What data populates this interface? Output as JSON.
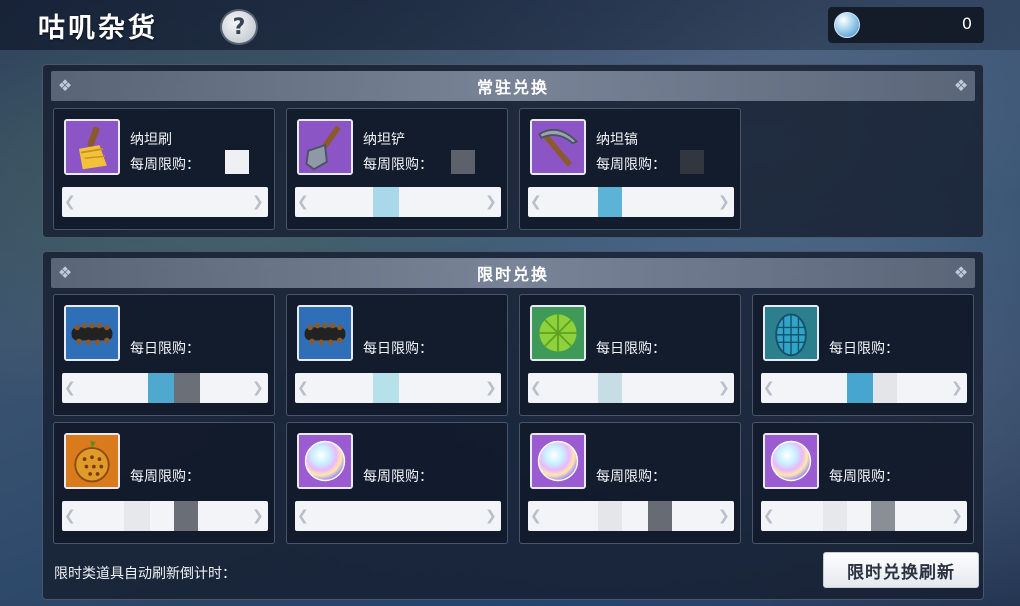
{
  "header": {
    "title": "咕叽杂货",
    "help_label": "?",
    "currency_icon": "crystal-orb-icon",
    "currency_value": "0"
  },
  "permanent": {
    "title": "常驻兑换",
    "items": [
      {
        "name": "纳坦刷",
        "limit_label": "每周限购：",
        "icon": "brush-icon"
      },
      {
        "name": "纳坦铲",
        "limit_label": "每周限购：",
        "icon": "shovel-icon"
      },
      {
        "name": "纳坦镐",
        "limit_label": "每周限购：",
        "icon": "pickaxe-icon"
      }
    ]
  },
  "limited": {
    "title": "限时兑换",
    "items": [
      {
        "limit_label": "每日限购：",
        "icon": "spiked-log-icon"
      },
      {
        "limit_label": "每日限购：",
        "icon": "spiked-log-icon"
      },
      {
        "limit_label": "每日限购：",
        "icon": "green-leaf-ball-icon"
      },
      {
        "limit_label": "每日限购：",
        "icon": "blue-scale-egg-icon"
      },
      {
        "limit_label": "每周限购：",
        "icon": "orange-fruit-icon"
      },
      {
        "limit_label": "每周限购：",
        "icon": "rainbow-orb-icon"
      },
      {
        "limit_label": "每周限购：",
        "icon": "rainbow-orb-icon"
      },
      {
        "limit_label": "每周限购：",
        "icon": "rainbow-orb-icon"
      }
    ]
  },
  "footer": {
    "countdown_label": "限时类道具自动刷新倒计时：",
    "refresh_button": "限时兑换刷新"
  },
  "colors": {
    "card_bg": "#121a2a",
    "bar_bg": "#f2f4f7",
    "accent_blue": "#4fa9cf",
    "accent_gray": "#6b6f78"
  }
}
